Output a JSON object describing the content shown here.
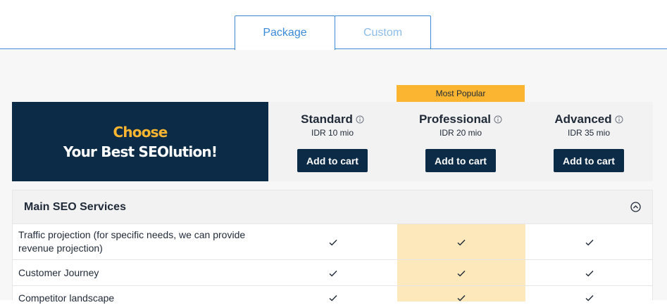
{
  "tabs": [
    {
      "label": "Package",
      "active": true
    },
    {
      "label": "Custom",
      "active": false
    }
  ],
  "hero": {
    "line1": "Choose",
    "line2": "Your Best SEOlution!"
  },
  "popular_badge": "Most Popular",
  "plans": [
    {
      "name": "Standard",
      "price": "IDR 10 mio",
      "button": "Add to cart"
    },
    {
      "name": "Professional",
      "price": "IDR 20 mio",
      "button": "Add to cart"
    },
    {
      "name": "Advanced",
      "price": "IDR 35 mio",
      "button": "Add to cart"
    }
  ],
  "section": {
    "title": "Main SEO Services",
    "rows": [
      {
        "label": "Traffic projection (for specific needs, we can provide revenue projection)",
        "standard": true,
        "professional": true,
        "advanced": true
      },
      {
        "label": "Customer Journey",
        "standard": true,
        "professional": true,
        "advanced": true
      },
      {
        "label": "Competitor landscape",
        "standard": true,
        "professional": true,
        "advanced": true
      }
    ]
  },
  "colors": {
    "accent": "#3b8ad9",
    "navy": "#0c2b47",
    "gold": "#fbb531",
    "highlight": "#fde8bc"
  }
}
